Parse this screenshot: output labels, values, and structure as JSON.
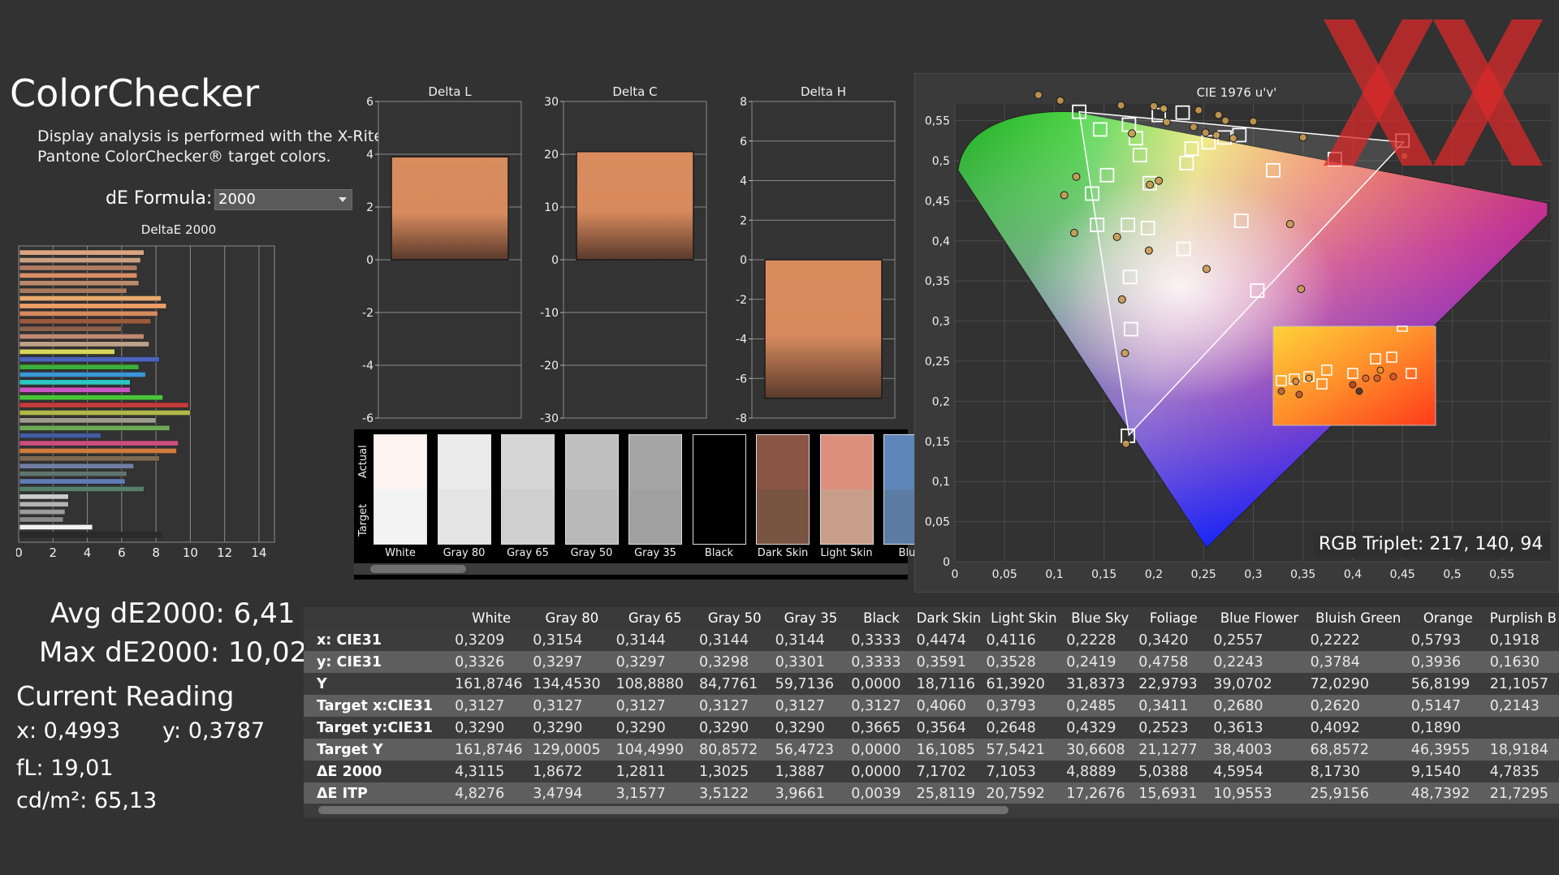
{
  "header": {
    "title": "ColorChecker",
    "description": "Display analysis is performed with the X-Rite/\nPantone ColorChecker® target colors.",
    "formula_label": "dE Formula:",
    "formula_value": "2000"
  },
  "stats": {
    "avg": "Avg dE2000: 6,41",
    "max": "Max dE2000: 10,02",
    "current_reading_label": "Current Reading",
    "x": "x: 0,4993",
    "y": "y: 0,3787",
    "fl": "fL: 19,01",
    "cdm2": "cd/m²: 65,13"
  },
  "deltae_chart": {
    "type": "bar",
    "title": "DeltaE 2000",
    "xticks": [
      "0",
      "2",
      "4",
      "6",
      "8",
      "10",
      "12",
      "14"
    ],
    "xlim": [
      0,
      14.9
    ],
    "values": [
      7.3,
      7.1,
      6.9,
      6.9,
      7.0,
      6.3,
      8.3,
      8.6,
      8.1,
      7.7,
      6.0,
      7.3,
      7.6,
      5.6,
      8.2,
      7.0,
      7.4,
      6.5,
      6.5,
      8.4,
      9.9,
      10.0,
      8.0,
      8.8,
      4.8,
      9.3,
      9.2,
      8.2,
      6.7,
      6.3,
      6.2,
      7.3,
      2.9,
      2.9,
      2.7,
      2.6,
      4.3,
      8.3
    ],
    "colors": [
      "#d9a57f",
      "#caa084",
      "#b17c64",
      "#d88f65",
      "#ba8a6e",
      "#a6795f",
      "#e8aa6c",
      "#ee9e66",
      "#d68a5e",
      "#9c5a3c",
      "#8c614c",
      "#c08a73",
      "#bba08a",
      "#d6d65a",
      "#4b63bd",
      "#3cae3a",
      "#3a96d6",
      "#2ac7c1",
      "#ca55c3",
      "#4ac53a",
      "#c43b3b",
      "#b0b94b",
      "#9e9c8d",
      "#6fa855",
      "#445b9d",
      "#ca4e7d",
      "#ce7d3f",
      "#7c6a53",
      "#727fa4",
      "#61746f",
      "#607db5",
      "#56806c",
      "#cbcbcb",
      "#b2b2b2",
      "#9c9c9c",
      "#898989",
      "#f2f2f2",
      "#2a2a2a"
    ]
  },
  "delta_charts": [
    {
      "title": "Delta L",
      "ticks": [
        "6",
        "4",
        "2",
        "0",
        "-2",
        "-4",
        "-6"
      ],
      "value": 3.9,
      "ylim": [
        -6,
        6
      ]
    },
    {
      "title": "Delta C",
      "ticks": [
        "30",
        "20",
        "10",
        "0",
        "-10",
        "-20",
        "-30"
      ],
      "value": 20.5,
      "ylim": [
        -30,
        30
      ]
    },
    {
      "title": "Delta H",
      "ticks": [
        "8",
        "6",
        "4",
        "2",
        "0",
        "-2",
        "-4",
        "-6",
        "-8"
      ],
      "value": -7.0,
      "ylim": [
        -8,
        8
      ]
    }
  ],
  "swatches": {
    "actual_label": "Actual",
    "target_label": "Target",
    "items": [
      {
        "name": "White",
        "actual": "#fdf4f2",
        "target": "#f3f3f3"
      },
      {
        "name": "Gray 80",
        "actual": "#ebebeb",
        "target": "#e4e4e4"
      },
      {
        "name": "Gray 65",
        "actual": "#d6d6d6",
        "target": "#cfcfcf"
      },
      {
        "name": "Gray 50",
        "actual": "#c0c0c0",
        "target": "#b9b9b9"
      },
      {
        "name": "Gray 35",
        "actual": "#a5a5a5",
        "target": "#a0a0a0"
      },
      {
        "name": "Black",
        "actual": "#000000",
        "target": "#000000"
      },
      {
        "name": "Dark Skin",
        "actual": "#8a5543",
        "target": "#7a5443"
      },
      {
        "name": "Light Skin",
        "actual": "#dd8f7d",
        "target": "#c89e8a"
      },
      {
        "name": "Blue",
        "actual": "#5e86b8",
        "target": "#5c7ca4"
      }
    ]
  },
  "table": {
    "columns": [
      "White",
      "Gray 80",
      "Gray 65",
      "Gray 50",
      "Gray 35",
      "Black",
      "Dark Skin",
      "Light Skin",
      "Blue Sky",
      "Foliage",
      "Blue Flower",
      "Bluish Green",
      "Orange",
      "Purplish B"
    ],
    "rows": [
      {
        "label": "x: CIE31",
        "values": [
          "0,3209",
          "0,3154",
          "0,3144",
          "0,3144",
          "0,3144",
          "0,3333",
          "0,4474",
          "0,4116",
          "0,2228",
          "0,3420",
          "0,2557",
          "0,2222",
          "0,5793",
          "0,1918"
        ]
      },
      {
        "label": "y: CIE31",
        "values": [
          "0,3326",
          "0,3297",
          "0,3297",
          "0,3298",
          "0,3301",
          "0,3333",
          "0,3591",
          "0,3528",
          "0,2419",
          "0,4758",
          "0,2243",
          "0,3784",
          "0,3936",
          "0,1630"
        ]
      },
      {
        "label": "Y",
        "values": [
          "161,8746",
          "134,4530",
          "108,8880",
          "84,7761",
          "59,7136",
          "0,0000",
          "18,7116",
          "61,3920",
          "31,8373",
          "22,9793",
          "39,0702",
          "72,0290",
          "56,8199",
          "21,1057"
        ]
      },
      {
        "label": "Target x:CIE31",
        "values": [
          "0,3127",
          "0,3127",
          "0,3127",
          "0,3127",
          "0,3127",
          "0,3127",
          "0,4060",
          "0,3793",
          "0,2485",
          "0,3411",
          "0,2680",
          "0,2620",
          "0,5147",
          "0,2143"
        ]
      },
      {
        "label": "Target y:CIE31",
        "values": [
          "0,3290",
          "0,3290",
          "0,3290",
          "0,3290",
          "0,3290",
          "0,3665",
          "0,3564",
          "0,2648",
          "0,4329",
          "0,2523",
          "0,3613",
          "0,4092",
          "0,1890",
          ""
        ]
      },
      {
        "label": "Target Y",
        "values": [
          "161,8746",
          "129,0005",
          "104,4990",
          "80,8572",
          "56,4723",
          "0,0000",
          "16,1085",
          "57,5421",
          "30,6608",
          "21,1277",
          "38,4003",
          "68,8572",
          "46,3955",
          "18,9184"
        ]
      },
      {
        "label": "ΔE 2000",
        "values": [
          "4,3115",
          "1,8672",
          "1,2811",
          "1,3025",
          "1,3887",
          "0,0000",
          "7,1702",
          "7,1053",
          "4,8889",
          "5,0388",
          "4,5954",
          "8,1730",
          "9,1540",
          "4,7835"
        ]
      },
      {
        "label": "ΔE ITP",
        "values": [
          "4,8276",
          "3,4794",
          "3,1577",
          "3,5122",
          "3,9661",
          "0,0039",
          "25,8119",
          "20,7592",
          "17,2676",
          "15,6931",
          "10,9553",
          "25,9156",
          "48,7392",
          "21,7295"
        ]
      }
    ]
  },
  "cie": {
    "title": "CIE 1976 u'v'",
    "xticks": [
      "0",
      "0,05",
      "0,1",
      "0,15",
      "0,2",
      "0,25",
      "0,3",
      "0,35",
      "0,4",
      "0,45",
      "0,5",
      "0,55"
    ],
    "yticks": [
      "0,55",
      "0,5",
      "0,45",
      "0,4",
      "0,35",
      "0,3",
      "0,25",
      "0,2",
      "0,15",
      "0,1",
      "0,05",
      "0"
    ],
    "rgb_triplet": "RGB Triplet: 217, 140, 94",
    "targets": [
      [
        0.125,
        0.561
      ],
      [
        0.146,
        0.539
      ],
      [
        0.175,
        0.545
      ],
      [
        0.182,
        0.528
      ],
      [
        0.205,
        0.557
      ],
      [
        0.229,
        0.56
      ],
      [
        0.186,
        0.507
      ],
      [
        0.233,
        0.497
      ],
      [
        0.238,
        0.515
      ],
      [
        0.255,
        0.523
      ],
      [
        0.271,
        0.529
      ],
      [
        0.286,
        0.532
      ],
      [
        0.32,
        0.488
      ],
      [
        0.382,
        0.502
      ],
      [
        0.45,
        0.525
      ],
      [
        0.153,
        0.482
      ],
      [
        0.138,
        0.459
      ],
      [
        0.196,
        0.472
      ],
      [
        0.143,
        0.42
      ],
      [
        0.174,
        0.42
      ],
      [
        0.194,
        0.416
      ],
      [
        0.288,
        0.425
      ],
      [
        0.23,
        0.39
      ],
      [
        0.176,
        0.355
      ],
      [
        0.304,
        0.338
      ],
      [
        0.177,
        0.29
      ],
      [
        0.174,
        0.157
      ]
    ],
    "measured": [
      [
        0.084,
        0.582
      ],
      [
        0.106,
        0.575
      ],
      [
        0.167,
        0.569
      ],
      [
        0.2,
        0.568
      ],
      [
        0.21,
        0.565
      ],
      [
        0.245,
        0.563
      ],
      [
        0.265,
        0.557
      ],
      [
        0.272,
        0.55
      ],
      [
        0.3,
        0.549
      ],
      [
        0.35,
        0.529
      ],
      [
        0.452,
        0.506
      ],
      [
        0.178,
        0.534
      ],
      [
        0.213,
        0.548
      ],
      [
        0.24,
        0.542
      ],
      [
        0.252,
        0.535
      ],
      [
        0.263,
        0.532
      ],
      [
        0.28,
        0.528
      ],
      [
        0.196,
        0.47
      ],
      [
        0.205,
        0.475
      ],
      [
        0.122,
        0.48
      ],
      [
        0.11,
        0.457
      ],
      [
        0.12,
        0.41
      ],
      [
        0.163,
        0.405
      ],
      [
        0.195,
        0.388
      ],
      [
        0.253,
        0.365
      ],
      [
        0.337,
        0.421
      ],
      [
        0.348,
        0.34
      ],
      [
        0.168,
        0.327
      ],
      [
        0.171,
        0.26
      ],
      [
        0.172,
        0.147
      ]
    ]
  }
}
